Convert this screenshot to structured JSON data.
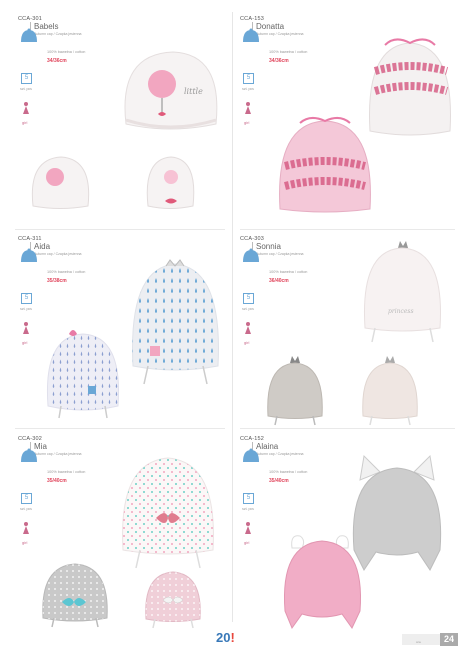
{
  "products": [
    {
      "code": "CCA-301",
      "name": "Babels",
      "subtitle": "Autumn cap / Czapka jesienna",
      "composition": "100% bawełna / cotton",
      "size": "34/36cm",
      "pieces": "5",
      "pieces_label": "szt. pcs",
      "gender": "girl",
      "accent": "#f2a6c0"
    },
    {
      "code": "CCA-153",
      "name": "Donatta",
      "subtitle": "Autumn cap / Czapka jesienna",
      "composition": "100% bawełna / cotton",
      "size": "34/36cm",
      "pieces": "5",
      "pieces_label": "szt. pcs",
      "gender": "girl",
      "accent": "#e05a9a"
    },
    {
      "code": "CCA-311",
      "name": "Aida",
      "subtitle": "Autumn cap / Czapka jesienna",
      "composition": "100% bawełna / cotton",
      "size": "35/38cm",
      "pieces": "5",
      "pieces_label": "szt. pcs",
      "gender": "girl",
      "accent": "#7aa8d8"
    },
    {
      "code": "CCA-303",
      "name": "Sonnia",
      "subtitle": "Autumn cap / Czapka jesienna",
      "composition": "100% bawełna / cotton",
      "size": "36/40cm",
      "pieces": "5",
      "pieces_label": "szt. pcs",
      "gender": "girl",
      "accent": "#f4e8e8"
    },
    {
      "code": "CCA-302",
      "name": "Mia",
      "subtitle": "Autumn cap / Czapka jesienna",
      "composition": "100% bawełna / cotton",
      "size": "35/40cm",
      "pieces": "5",
      "pieces_label": "szt. pcs",
      "gender": "girl",
      "accent": "#6ccfc7"
    },
    {
      "code": "CCA-152",
      "name": "Alaina",
      "subtitle": "Autumn cap / Czapka jesienna",
      "composition": "100% bawełna / cotton",
      "size": "35/40cm",
      "pieces": "5",
      "pieces_label": "szt. pcs",
      "gender": "girl",
      "accent": "#c9c9c9"
    }
  ],
  "footer": {
    "logo_main": "20",
    "logo_accent": "!",
    "page_number": "24",
    "page_small": "cca"
  },
  "icons": {
    "hat": "hat-icon",
    "girl": "girl-figure-icon"
  },
  "colors": {
    "brand_blue": "#3878b8",
    "brand_red": "#e8473d",
    "size_red": "#e0435a",
    "icon_blue": "#6aa7d6",
    "girl_pink": "#c96a8c"
  }
}
